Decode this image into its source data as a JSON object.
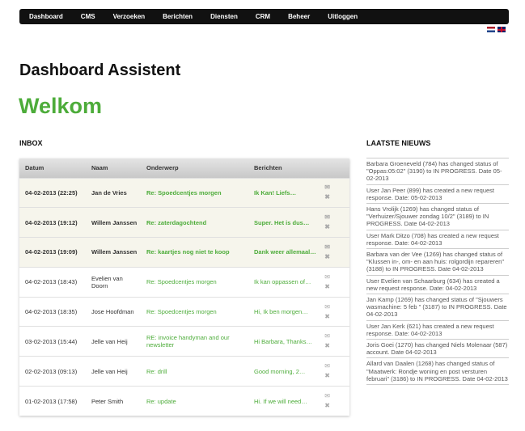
{
  "nav": [
    "Dashboard",
    "CMS",
    "Verzoeken",
    "Berichten",
    "Diensten",
    "CRM",
    "Beheer",
    "Uitloggen"
  ],
  "page_title": "Dashboard Assistent",
  "welcome": "Welkom",
  "inbox": {
    "title": "INBOX",
    "columns": [
      "Datum",
      "Naam",
      "Onderwerp",
      "Berichten"
    ],
    "rows": [
      {
        "date": "04-02-2013 (22:25)",
        "name": "Jan de Vries",
        "subject": "Re: Spoedcentjes morgen",
        "message": "Ik Kan! Liefs…",
        "unread": true
      },
      {
        "date": "04-02-2013 (19:12)",
        "name": "Willem Janssen",
        "subject": "Re: zaterdagochtend",
        "message": "Super. Het is dus…",
        "unread": true
      },
      {
        "date": "04-02-2013 (19:09)",
        "name": "Willem Janssen",
        "subject": "Re: kaartjes nog niet te koop",
        "message": "Dank weer allemaal…",
        "unread": true
      },
      {
        "date": "04-02-2013 (18:43)",
        "name": "Evelien van Doorn",
        "subject": "Re: Spoedcentjes morgen",
        "message": "Ik kan oppassen of…",
        "unread": false
      },
      {
        "date": "04-02-2013 (18:35)",
        "name": "Jose Hoofdman",
        "subject": "Re: Spoedcentjes morgen",
        "message": "Hi, Ik ben morgen…",
        "unread": false
      },
      {
        "date": "03-02-2013 (15:44)",
        "name": "Jelle van Heij",
        "subject": "RE: invoice handyman and our newsletter",
        "message": "Hi Barbara, Thanks…",
        "unread": false
      },
      {
        "date": "02-02-2013 (09:13)",
        "name": "Jelle van Heij",
        "subject": "Re: drill",
        "message": "Good morning, 2…",
        "unread": false
      },
      {
        "date": "01-02-2013 (17:58)",
        "name": "Peter Smith",
        "subject": "Re: update",
        "message": "Hi. If we will need…",
        "unread": false
      }
    ]
  },
  "news": {
    "title": "LAATSTE NIEUWS",
    "items": [
      "Barbara Groeneveld (784) has changed status of \"Oppas:05:02\" (3190) to IN PROGRESS. Date 05-02-2013",
      "User Jan Peer (899) has created a new request response. Date: 05-02-2013",
      "Hans Vrolijk (1269) has changed status of \"Verhuizer/Sjouwer zondag 10/2\" (3189) to IN PROGRESS. Date 04-02-2013",
      "User Mark Ditzo (708) has created a new request response. Date: 04-02-2013",
      "Barbara van der Vee (1269) has changed status of \"Klussen in-, om- en aan huis: rolgordijn repareren\" (3188) to IN PROGRESS. Date 04-02-2013",
      "User Evelien van Schaarburg (634) has created a new request response. Date: 04-02-2013",
      "Jan Kamp (1269) has changed status of \"Sjouwers wasmachine: 5 feb \" (3187) to IN PROGRESS. Date 04-02-2013",
      "User Jan Kerk (621) has created a new request response. Date: 04-02-2013",
      "Joris Goei (1270) has changed Niels Molenaar (587) account. Date 04-02-2013",
      "Allard van Daalen (1268) has changed status of \"Maatwerk: Rondje woning en post versturen februari\" (3186) to IN PROGRESS. Date 04-02-2013"
    ]
  }
}
